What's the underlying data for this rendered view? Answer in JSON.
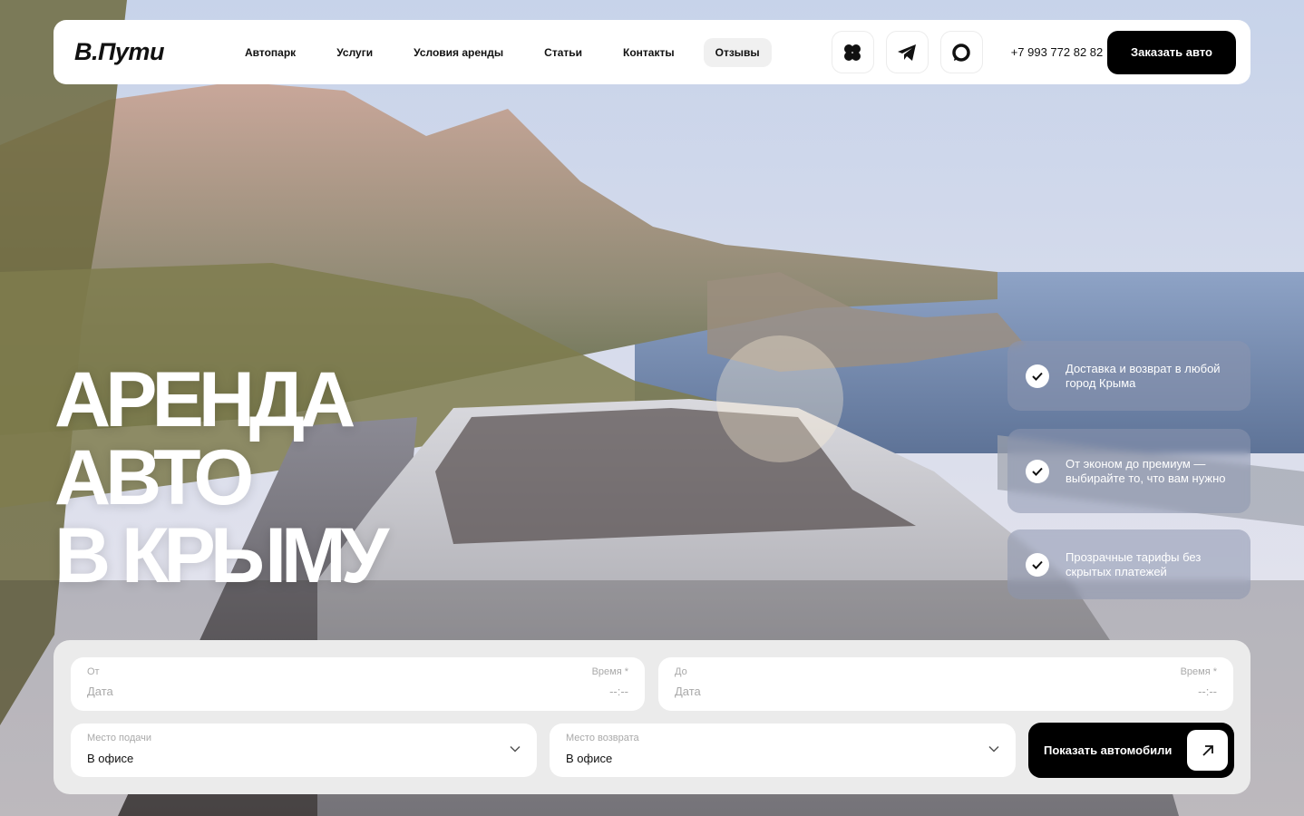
{
  "header": {
    "logo": "В.Пути",
    "nav": [
      "Автопарк",
      "Услуги",
      "Условия аренды",
      "Статьи",
      "Контакты",
      "Отзывы"
    ],
    "active_nav": "Отзывы",
    "socials": [
      "vk-icon",
      "telegram-icon",
      "max-chat-icon"
    ],
    "phone": "+7 993 772 82 82",
    "order_label": "Заказать авто"
  },
  "hero": {
    "title_lines": [
      "АРЕНДА",
      "АВТО",
      "В КРЫМУ"
    ]
  },
  "features": [
    "Доставка и возврат в любой город Крыма",
    "От эконом до премиум — выбирайте то, что вам нужно",
    "Прозрачные тарифы без скрытых платежей"
  ],
  "booking": {
    "from": {
      "label": "От",
      "placeholder": "Дата",
      "time_label": "Время *",
      "time_placeholder": "--:--"
    },
    "to": {
      "label": "До",
      "placeholder": "Дата",
      "time_label": "Время *",
      "time_placeholder": "--:--"
    },
    "pickup": {
      "label": "Место подачи",
      "value": "В офисе"
    },
    "return": {
      "label": "Место возврата",
      "value": "В офисе"
    },
    "submit_label": "Показать автомобили"
  },
  "colors": {
    "accent": "#000000",
    "panel": "#ebebeb",
    "card": "#ffffff"
  }
}
